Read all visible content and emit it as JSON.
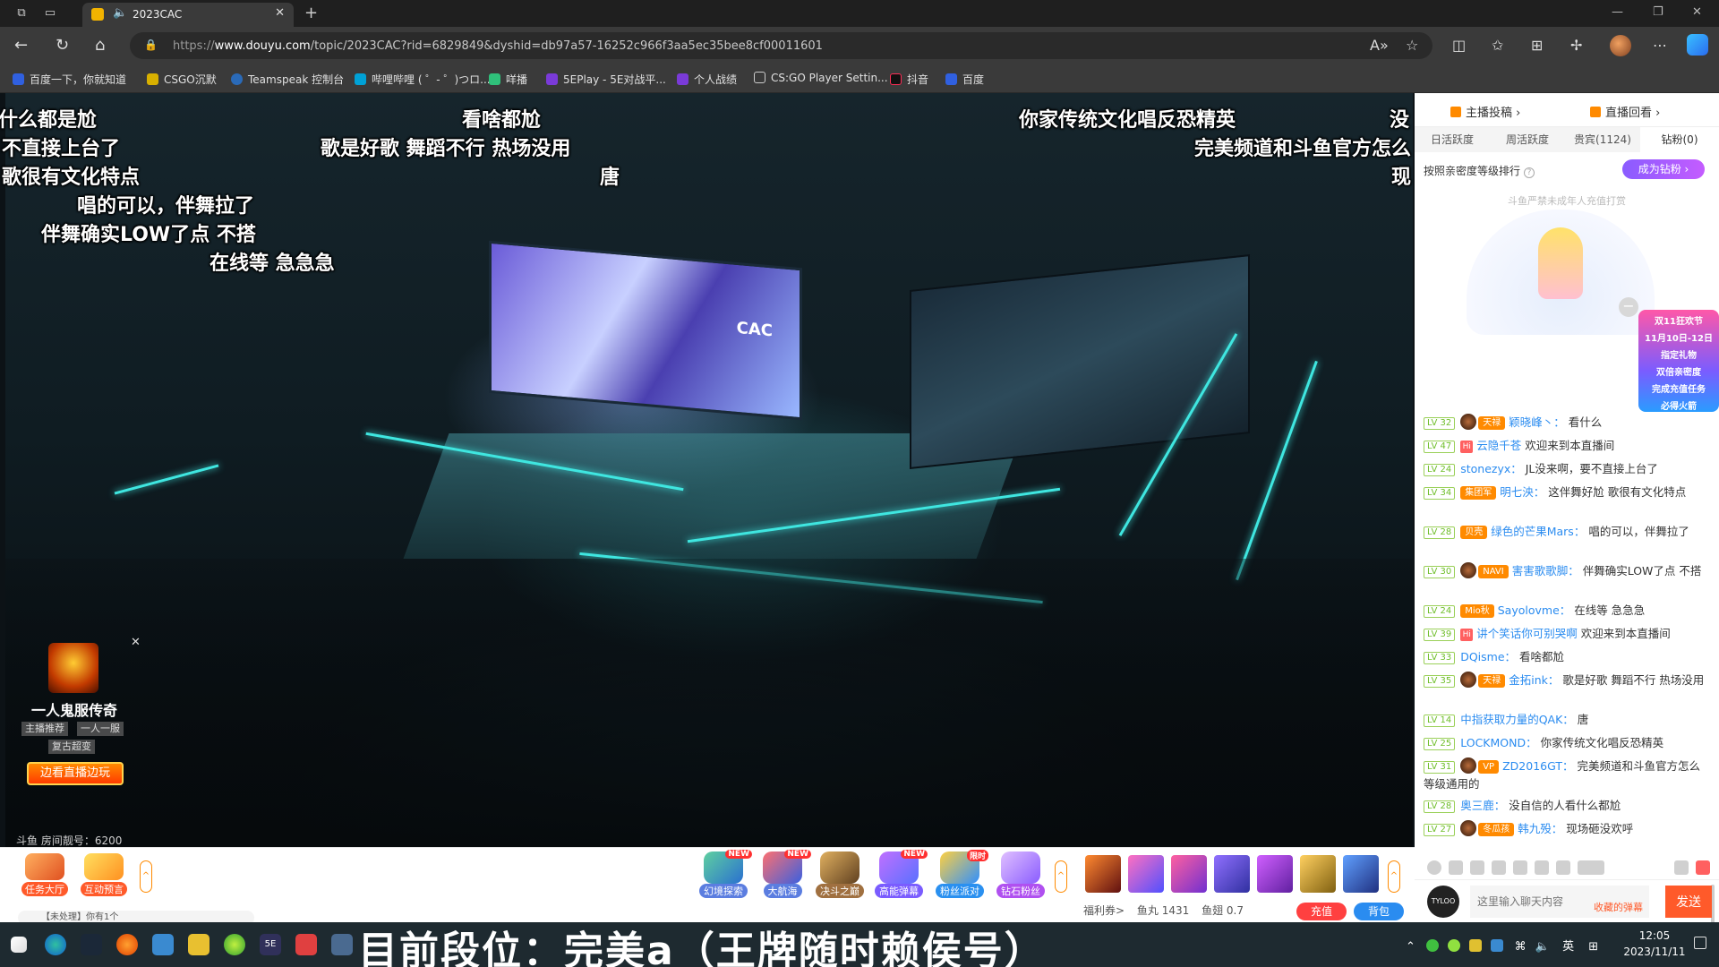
{
  "browser": {
    "tab_title": "2023CAC",
    "url_prefix": "https://",
    "url_host": "www.douyu.com",
    "url_rest": "/topic/2023CAC?rid=6829849&dyshid=db97a57-16252c966f3aa5ec35bee8cf00011601",
    "bookmarks": [
      "百度一下，你就知道",
      "CSGO沉默",
      "Teamspeak 控制台",
      "哔哩哔哩 ( ゜- ゜)つロ...",
      "咩播",
      "5EPlay - 5E对战平...",
      "个人战绩",
      "CS:GO Player Settin...",
      "抖音",
      "百度"
    ]
  },
  "video": {
    "screen_text": "CAC",
    "danmaku": [
      {
        "text": "什么都是尬"
      },
      {
        "text": "不直接上台了"
      },
      {
        "text": "歌很有文化特点"
      },
      {
        "text": "唱的可以，伴舞拉了"
      },
      {
        "text": "伴舞确实LOW了点 不搭"
      },
      {
        "text": "在线等 急急急"
      },
      {
        "text": "看啥都尬"
      },
      {
        "text": "歌是好歌 舞蹈不行 热场没用"
      },
      {
        "text": "唐"
      },
      {
        "text": "你家传统文化唱反恐精英"
      },
      {
        "text": "完美频道和斗鱼官方怎么"
      },
      {
        "text": "没"
      },
      {
        "text": "现"
      }
    ],
    "room_number": "斗鱼 房间靓号：6200"
  },
  "ad": {
    "title": "一人鬼服传奇",
    "tags": [
      "主播推荐",
      "一人一服",
      "复古超变"
    ],
    "button": "边看直播边玩"
  },
  "toolbar": {
    "tasks": [
      {
        "label": "任务大厅"
      },
      {
        "label": "互动预言"
      }
    ],
    "gifts": [
      {
        "label": "幻境探索",
        "new": "NEW"
      },
      {
        "label": "大航海",
        "new": "NEW"
      },
      {
        "label": "决斗之巅",
        "new": ""
      },
      {
        "label": "高能弹幕",
        "new": "NEW"
      },
      {
        "label": "粉丝派对",
        "new": "限时"
      },
      {
        "label": "钻石粉丝",
        "new": ""
      }
    ],
    "notice_line1": "...",
    "notice_line2": "【未处理】你有1个"
  },
  "wallet": {
    "coupon": "福利券>",
    "fishball": "鱼丸 1431",
    "fin": "鱼翅 0.7",
    "recharge": "充值",
    "bag": "背包"
  },
  "panel": {
    "links": [
      "主播投稿 ›",
      "直播回看 ›"
    ],
    "rank_tabs": [
      "日活跃度",
      "周活跃度",
      "贵宾(1124)",
      "钻粉(0)"
    ],
    "rank_hint": "按照亲密度等级排行",
    "join_label": "成为钻粉 ›",
    "minor_note": "斗鱼严禁未成年人充值打赏",
    "promo_lines": [
      "双11狂欢节",
      "11月10日-12日",
      "指定礼物",
      "双倍亲密度",
      "完成充值任务",
      "必得火箭"
    ],
    "input_placeholder": "这里输入聊天内容",
    "collect": "收藏的弹幕",
    "send": "发送",
    "me_label": "TYLOO"
  },
  "chat": [
    {
      "lv": "LV 32",
      "badge": "天禄",
      "nick": "颖晓峰丶：",
      "text": "看什么"
    },
    {
      "lv": "LV 47",
      "badge": "",
      "nick": "云隐千苍",
      "text": "欢迎来到本直播间"
    },
    {
      "lv": "LV 24",
      "badge": "",
      "nick": "stonezyx：",
      "text": "JL没来啊，要不直接上台了"
    },
    {
      "lv": "LV 34",
      "badge": "集团军",
      "nick": "明七泱：",
      "text": "这伴舞好尬 歌很有文化特点"
    },
    {
      "lv": "LV 28",
      "badge": "贝壳",
      "nick": "绿色的芒果Mars：",
      "text": "唱的可以，伴舞拉了"
    },
    {
      "lv": "LV 30",
      "badge": "NAVI",
      "nick": "害害歌歌脚：",
      "text": "伴舞确实LOW了点 不搭"
    },
    {
      "lv": "LV 24",
      "badge": "Mio秋",
      "nick": "Sayolovme：",
      "text": "在线等 急急急"
    },
    {
      "lv": "LV 39",
      "badge": "",
      "nick": "讲个笑话你可别哭啊",
      "text": "欢迎来到本直播间"
    },
    {
      "lv": "LV 33",
      "badge": "",
      "nick": "DQisme：",
      "text": "看啥都尬"
    },
    {
      "lv": "LV 35",
      "badge": "天禄",
      "nick": "金拓ink：",
      "text": "歌是好歌 舞蹈不行 热场没用"
    },
    {
      "lv": "LV 14",
      "badge": "",
      "nick": "中指获取力量的QAK：",
      "text": "唐"
    },
    {
      "lv": "LV 25",
      "badge": "",
      "nick": "LOCKMOND：",
      "text": "你家传统文化唱反恐精英"
    },
    {
      "lv": "LV 31",
      "badge": "VP",
      "nick": "ZD2016GT：",
      "text": "完美频道和斗鱼官方怎么等级通用的"
    },
    {
      "lv": "LV 28",
      "badge": "",
      "nick": "奥三鹿：",
      "text": "没自信的人看什么都尬"
    },
    {
      "lv": "LV 27",
      "badge": "冬瓜孩",
      "nick": "韩九殁：",
      "text": "现场砸没欢呼"
    }
  ],
  "taskbar": {
    "overlay_text": "目前段位：完美a（王牌随时赖侯号）",
    "ime": "英",
    "time": "12:05",
    "date": "2023/11/11"
  }
}
